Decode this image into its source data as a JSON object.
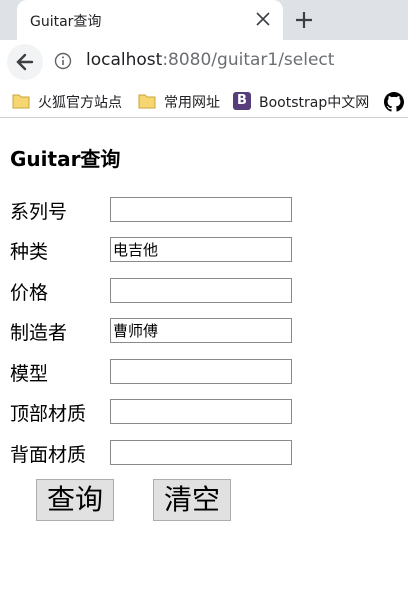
{
  "browser": {
    "tab_title": "Guitar查询",
    "url_host": "localhost",
    "url_path": ":8080/guitar1/select",
    "bookmarks": [
      "火狐官方站点",
      "常用网址",
      "Bootstrap中文网"
    ],
    "bootstrap_letter": "B"
  },
  "page": {
    "title": "Guitar查询",
    "fields": [
      {
        "label": "系列号",
        "value": ""
      },
      {
        "label": "种类",
        "value": "电吉他"
      },
      {
        "label": "价格",
        "value": ""
      },
      {
        "label": "制造者",
        "value": "曹师傅"
      },
      {
        "label": "模型",
        "value": ""
      },
      {
        "label": "顶部材质",
        "value": ""
      },
      {
        "label": "背面材质",
        "value": ""
      }
    ],
    "query_button": "查询",
    "clear_button": "清空"
  },
  "colors": {
    "tabbar": "#dee1e6",
    "button_bg": "#e1e1e1",
    "bootstrap": "#563d7c"
  }
}
